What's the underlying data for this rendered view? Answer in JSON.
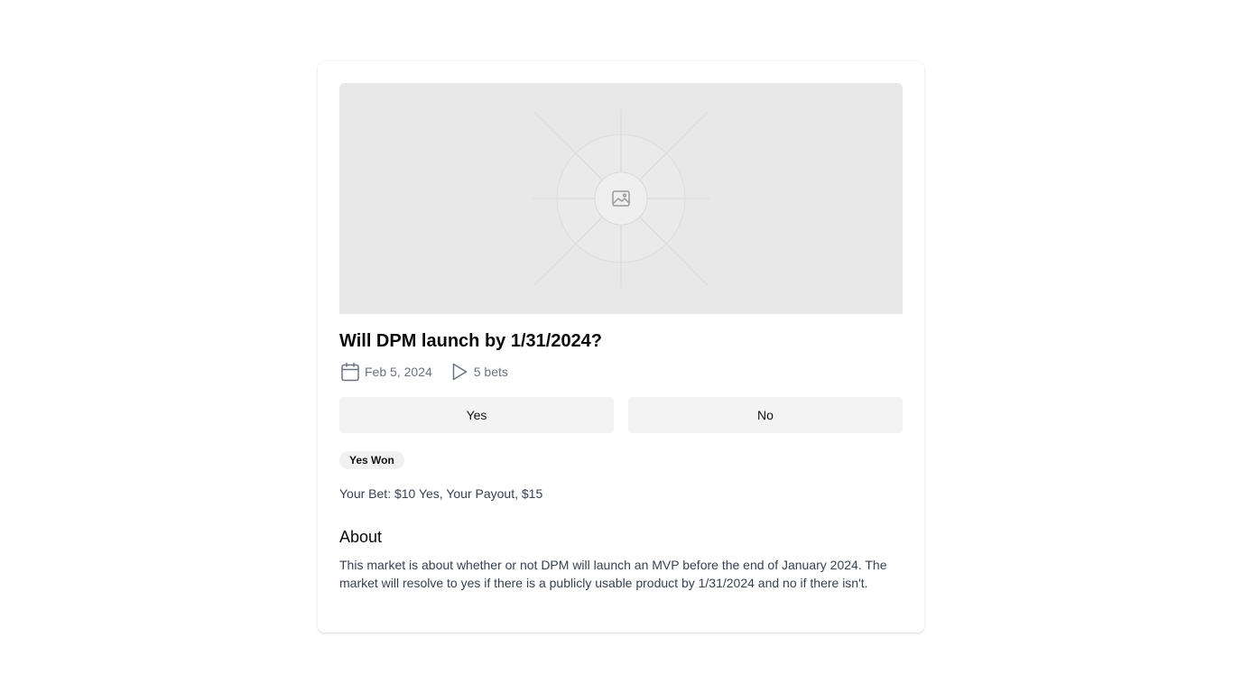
{
  "market": {
    "title": "Will DPM launch by 1/31/2024?",
    "date": "Feb 5, 2024",
    "bets": "5 bets",
    "date_icon": "calendar-icon",
    "bets_icon": "play-icon",
    "image_icon": "image-icon"
  },
  "actions": {
    "yes_label": "Yes",
    "no_label": "No"
  },
  "result": {
    "badge": "Yes Won",
    "bet_summary": "Your Bet: $10 Yes, Your Payout, $15"
  },
  "about": {
    "heading": "About",
    "text": "This market is about whether or not DPM will launch an MVP before the end of January 2024. The market will resolve to yes if there is a publicly usable product by 1/31/2024 and no if there isn't."
  },
  "colors": {
    "placeholder_bg": "#e8e8e8",
    "button_bg": "#f3f3f3",
    "muted_text": "#6b7280",
    "body_text": "#374151"
  }
}
